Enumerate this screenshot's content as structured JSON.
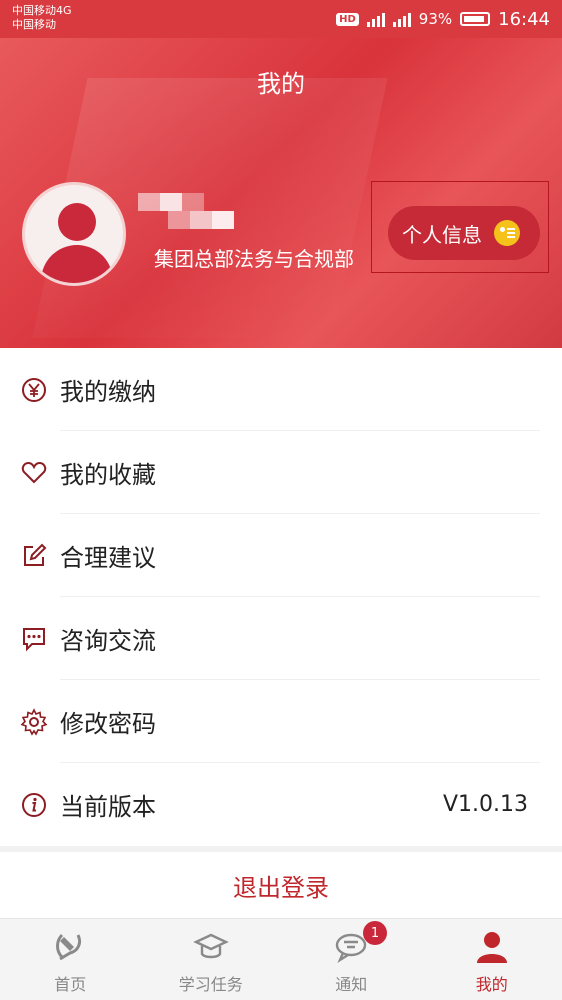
{
  "status_bar": {
    "carrier_line1": "中国移动4G",
    "carrier_line2": "中国移动",
    "hd": "HD",
    "battery": "93%",
    "time": "16:44"
  },
  "header": {
    "title": "我的",
    "department": "集团总部法务与合规部",
    "info_button_label": "个人信息",
    "avatar_color": "#c9293a"
  },
  "menu": {
    "items": [
      {
        "label": "我的缴纳",
        "icon": "yen-circle-icon"
      },
      {
        "label": "我的收藏",
        "icon": "heart-icon"
      },
      {
        "label": "合理建议",
        "icon": "edit-icon"
      },
      {
        "label": "咨询交流",
        "icon": "chat-icon"
      },
      {
        "label": "修改密码",
        "icon": "gear-icon"
      },
      {
        "label": "当前版本",
        "icon": "info-icon",
        "value": "V1.0.13"
      }
    ]
  },
  "logout_label": "退出登录",
  "tabbar": {
    "tabs": [
      {
        "label": "首页",
        "icon": "party-emblem-icon"
      },
      {
        "label": "学习任务",
        "icon": "graduation-cap-icon"
      },
      {
        "label": "通知",
        "icon": "notification-chat-icon",
        "badge": "1"
      },
      {
        "label": "我的",
        "icon": "user-icon",
        "active": true
      }
    ]
  },
  "colors": {
    "brand_red": "#c0272d",
    "header_red": "#d9333c",
    "badge_red": "#c9283a",
    "id_card_yellow": "#f5c21b"
  }
}
